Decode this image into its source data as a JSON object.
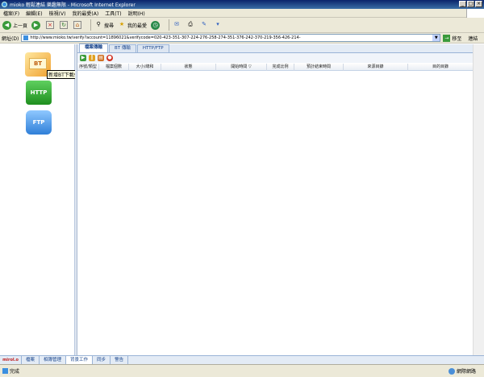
{
  "window": {
    "title": "mioko 輕鬆連結 樂趣無限 - Microsoft Internet Explorer"
  },
  "menu": [
    "檔案(F)",
    "編輯(E)",
    "檢視(V)",
    "我的最愛(A)",
    "工具(T)",
    "說明(H)"
  ],
  "toolbar": {
    "back": "上一頁",
    "search": "搜尋",
    "favorites": "我的最愛"
  },
  "address": {
    "label": "網址(D)",
    "url": "http://www.mioko.tw/verify?account=11896021&verifycode=020-423-351-307-224-276-258-274-351-376-242-370-219-356-426-214-",
    "go": "移至",
    "links": "連結"
  },
  "sidebar": {
    "bt": "BT",
    "http": "HTTP",
    "ftp": "FTP",
    "tooltip": "新增BT下載任務"
  },
  "tabs": [
    "檔案傳輸",
    "BT 傳輸",
    "HTTP/FTP"
  ],
  "columns": [
    "序號/類型",
    "檔案個數",
    "大小/總和",
    "狀態",
    "開始時間 ▽",
    "完成比例",
    "預計結束時間",
    "來源目錄",
    "目的目錄"
  ],
  "bottom": {
    "brand": "mirol.o",
    "tabs": [
      "檔案",
      "相簿管理",
      "背景工作",
      "同步",
      "警告"
    ]
  },
  "status": {
    "text": "完成",
    "zone": "網際網路"
  }
}
